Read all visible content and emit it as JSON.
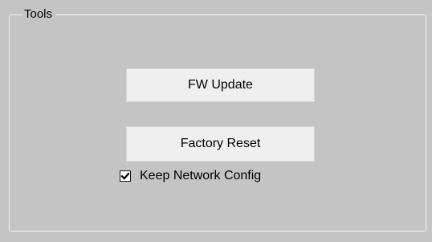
{
  "tools_group": {
    "title": "Tools",
    "fw_update_label": "FW Update",
    "factory_reset_label": "Factory Reset",
    "keep_network_config": {
      "label": "Keep Network Config",
      "checked": true
    }
  },
  "colors": {
    "background": "#c4c4c4",
    "button_face": "#efefef",
    "groupbox_border": "#f2f2f2"
  },
  "icons": {
    "checkbox_mark": "checkmark-icon"
  }
}
